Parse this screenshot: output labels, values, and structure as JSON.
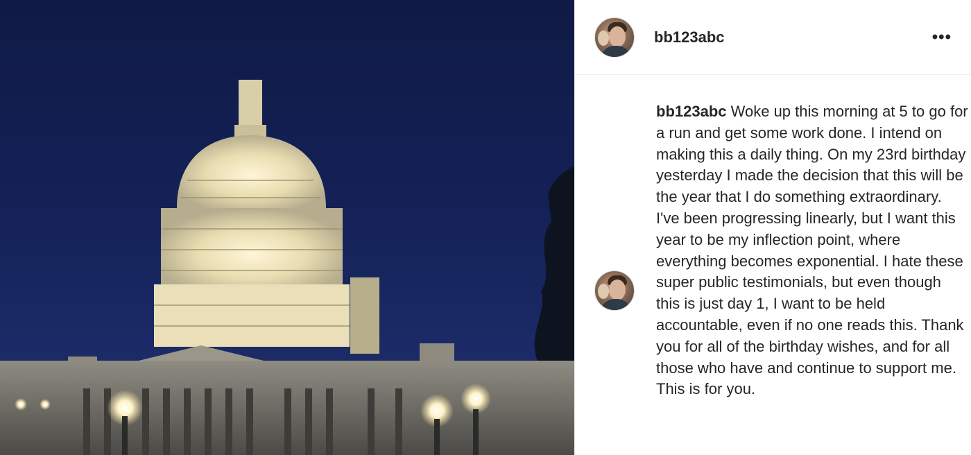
{
  "post": {
    "username": "bb123abc",
    "more_label": "•••",
    "caption": {
      "author": "bb123abc",
      "text": "Woke up this morning at 5 to go for a run and get some work done. I intend on making this a daily thing. On my 23rd birthday yesterday I made the decision that this will be the year that I do something extraordinary. I've been progressing linearly, but I want this year to be my inflection point, where everything becomes exponential. I hate these super public testimonials, but even though this is just day 1, I want to be held accountable, even if no one reads this. Thank you for all of the birthday wishes, and for all those who have and continue to support me. This is for you."
    }
  },
  "icons": {
    "more": "more-options-icon"
  },
  "colors": {
    "sky": "#142157",
    "text": "#262626",
    "divider": "#efefef"
  }
}
